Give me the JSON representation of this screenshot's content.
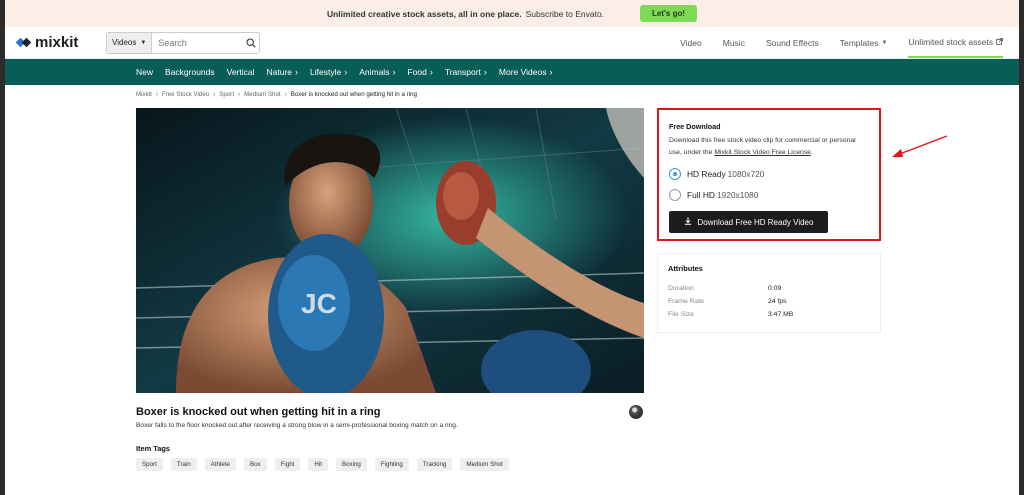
{
  "promo": {
    "text_bold": "Unlimited creative stock assets, all in one place.",
    "text": "Subscribe to Envato.",
    "cta": "Let's go!"
  },
  "header": {
    "logo": "mixkit",
    "search_type": "Videos",
    "search_placeholder": "Search",
    "nav": {
      "video": "Video",
      "music": "Music",
      "sound_effects": "Sound Effects",
      "templates": "Templates",
      "unlimited": "Unlimited stock assets"
    }
  },
  "categories": [
    "New",
    "Backgrounds",
    "Vertical",
    "Nature",
    "Lifestyle",
    "Animals",
    "Food",
    "Transport",
    "More Videos"
  ],
  "breadcrumb": [
    "Mixkit",
    "Free Stock Video",
    "Sport",
    "Medium Shot",
    "Boxer is knocked out when getting hit in a ring"
  ],
  "video": {
    "title": "Boxer is knocked out when getting hit in a ring",
    "description": "Boxer falls to the floor knocked out after receiving a strong blow in a semi-professional boxing match on a ring.",
    "tags_heading": "Item Tags",
    "tags": [
      "Sport",
      "Train",
      "Athlete",
      "Box",
      "Fight",
      "Hit",
      "Boxing",
      "Fighting",
      "Tracking",
      "Medium Shot"
    ]
  },
  "download": {
    "heading": "Free Download",
    "desc": "Download this free stock video clip for commercial or personal use, under the",
    "license": "Mixkit Stock Video Free License",
    "option1_label": "HD Ready",
    "option1_res": "1080x720",
    "option2_label": "Full HD",
    "option2_res": "1920x1080",
    "button": "Download Free HD Ready Video"
  },
  "attributes": {
    "heading": "Attributes",
    "rows": [
      {
        "k": "Duration",
        "v": "0:09"
      },
      {
        "k": "Frame Rate",
        "v": "24 fps"
      },
      {
        "k": "File Size",
        "v": "3.47 MB"
      }
    ]
  },
  "colors": {
    "accent_green": "#7ed957",
    "category_bar": "#085d56",
    "highlight_red": "#e3141c"
  }
}
